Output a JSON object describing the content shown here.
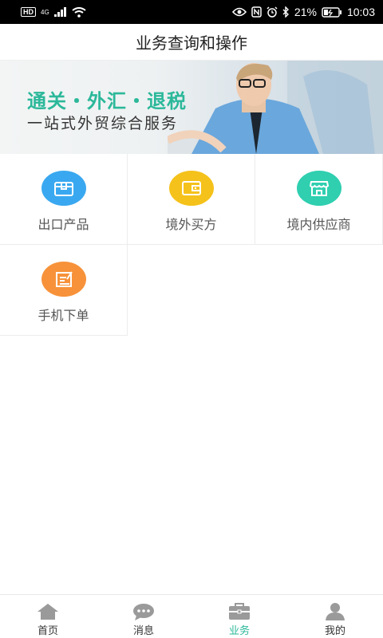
{
  "status_bar": {
    "hd": "HD",
    "network": "4G",
    "battery_percent": "21%",
    "time": "10:03"
  },
  "header": {
    "title": "业务查询和操作"
  },
  "banner": {
    "headline": "通关・外汇・退税",
    "subline": "一站式外贸综合服务"
  },
  "tiles": [
    {
      "label": "出口产品",
      "icon": "box-icon",
      "color": "#3aa8f0"
    },
    {
      "label": "境外买方",
      "icon": "wallet-icon",
      "color": "#f5c21b"
    },
    {
      "label": "境内供应商",
      "icon": "store-icon",
      "color": "#2fcfb0"
    },
    {
      "label": "手机下单",
      "icon": "note-icon",
      "color": "#f7923a"
    }
  ],
  "bottom_nav": [
    {
      "label": "首页",
      "icon": "home-icon"
    },
    {
      "label": "消息",
      "icon": "chat-icon"
    },
    {
      "label": "业务",
      "icon": "briefcase-icon",
      "active": true
    },
    {
      "label": "我的",
      "icon": "user-icon"
    }
  ],
  "colors": {
    "accent": "#2bb89a",
    "inactive_icon": "#9a9a9a"
  }
}
